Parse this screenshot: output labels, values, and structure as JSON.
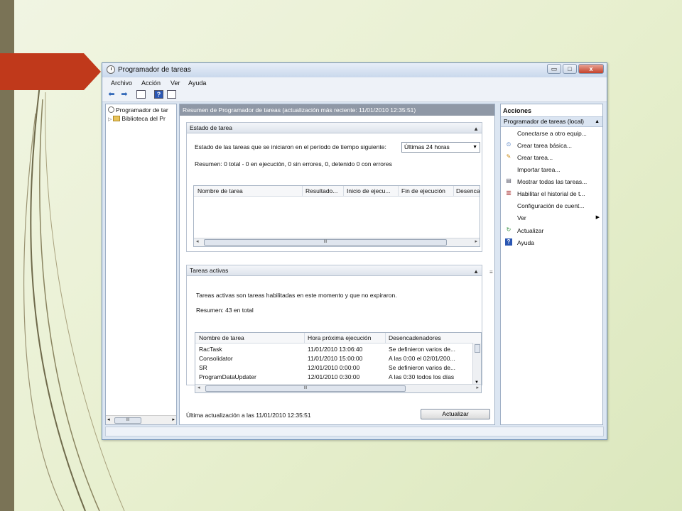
{
  "window": {
    "title": "Programador de tareas"
  },
  "menu": [
    "Archivo",
    "Acción",
    "Ver",
    "Ayuda"
  ],
  "tree": {
    "items": [
      "Programador de tar",
      "Biblioteca del Pr"
    ],
    "scroll_label": "III"
  },
  "center": {
    "header": "Resumen de Programador de tareas (actualización más reciente: 11/01/2010 12:35:51)",
    "status_section": {
      "title": "Estado de tarea",
      "prompt": "Estado de las tareas que se iniciaron en el período de tiempo siguiente:",
      "period_value": "Últimas 24 horas",
      "summary": "Resumen: 0 total - 0 en ejecución, 0 sin errores, 0, detenido  0 con errores",
      "columns": [
        "Nombre de tarea",
        "Resultado...",
        "Inicio de ejecu...",
        "Fin de ejecución",
        "Desenca"
      ],
      "scroll_label": "III"
    },
    "active_section": {
      "title": "Tareas activas",
      "description": "Tareas activas son tareas habilitadas en este momento y que no expiraron.",
      "summary": "Resumen: 43 en total",
      "columns": [
        "Nombre de tarea",
        "Hora próxima ejecución",
        "Desencadenadores"
      ],
      "rows": [
        [
          "RacTask",
          "11/01/2010 13:06:40",
          "Se definieron varios de..."
        ],
        [
          "Consolidator",
          "11/01/2010 15:00:00",
          "A las 0:00 el 02/01/200..."
        ],
        [
          "SR",
          "12/01/2010 0:00:00",
          "Se definieron varios de..."
        ],
        [
          "ProgramDataUpdater",
          "12/01/2010 0:30:00",
          "A las 0:30 todos los días"
        ]
      ],
      "scroll_label": "III"
    },
    "footer": "Última actualización a las 11/01/2010 12:35:51",
    "refresh_button": "Actualizar"
  },
  "actions": {
    "title": "Acciones",
    "group": "Programador de tareas (local)",
    "items": [
      "Conectarse a otro equip...",
      "Crear tarea básica...",
      "Crear tarea...",
      "Importar tarea...",
      "Mostrar todas las tareas...",
      "Habilitar el historial de t...",
      "Configuración de cuent...",
      "Ver",
      "Actualizar",
      "Ayuda"
    ]
  },
  "colors": {
    "accent_red": "#c0391b",
    "header_gray": "#8f98a6",
    "window_frame": "#dce6f2"
  },
  "icons": [
    "clock-icon",
    "folder-icon",
    "back-arrow-icon",
    "forward-arrow-icon",
    "help-icon",
    "refresh-icon"
  ]
}
